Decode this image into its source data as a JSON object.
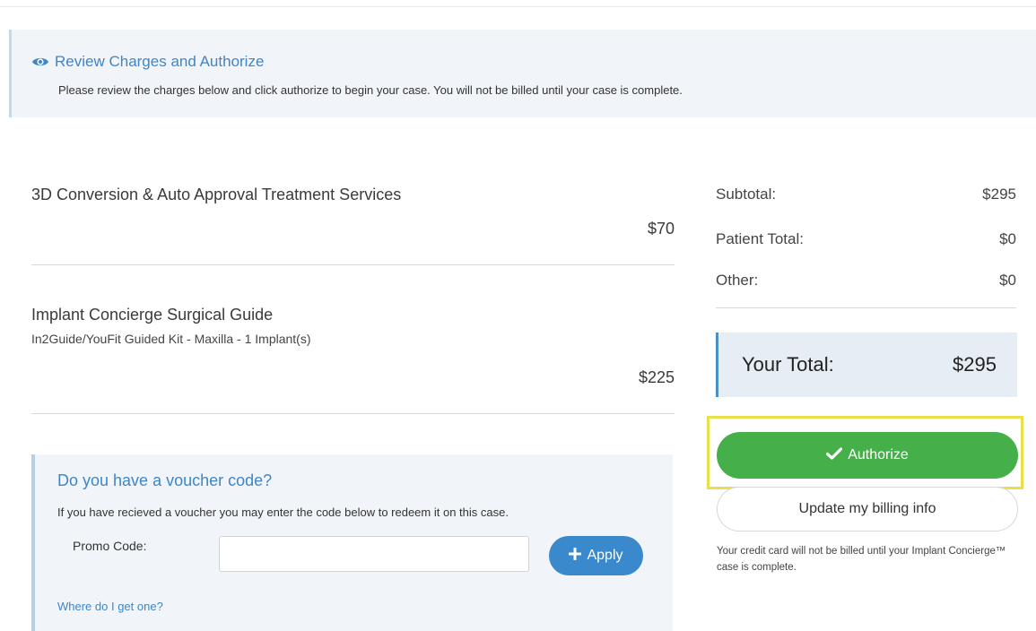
{
  "banner": {
    "title": "Review Charges and Authorize",
    "message": "Please review the charges below and click authorize to begin your case. You will not be billed until your case is complete."
  },
  "items": [
    {
      "name": "3D Conversion & Auto Approval Treatment Services",
      "sub": "",
      "price": "$70"
    },
    {
      "name": "Implant Concierge Surgical Guide",
      "sub": "In2Guide/YouFit Guided Kit - Maxilla - 1 Implant(s)",
      "price": "$225"
    }
  ],
  "summary": {
    "subtotal_label": "Subtotal:",
    "subtotal_value": "$295",
    "patient_label": "Patient Total:",
    "patient_value": "$0",
    "other_label": "Other:",
    "other_value": "$0",
    "total_label": "Your Total:",
    "total_value": "$295"
  },
  "actions": {
    "authorize_label": "Authorize",
    "billing_label": "Update my billing info",
    "footnote": "Your credit card will not be billed until your Implant Concierge™ case is complete."
  },
  "voucher": {
    "title": "Do you have a voucher code?",
    "description": "If you have recieved a voucher you may enter the code below to redeem it on this case.",
    "promo_label": "Promo Code:",
    "promo_value": "",
    "apply_label": "Apply",
    "link": "Where do I get one?"
  },
  "colors": {
    "accent_blue": "#3e86c7",
    "authorize_green": "#45b049",
    "highlight_yellow": "#e8e04a"
  },
  "icons": {
    "banner": "eye-icon",
    "authorize": "checkmark-icon",
    "apply": "plus-icon"
  }
}
